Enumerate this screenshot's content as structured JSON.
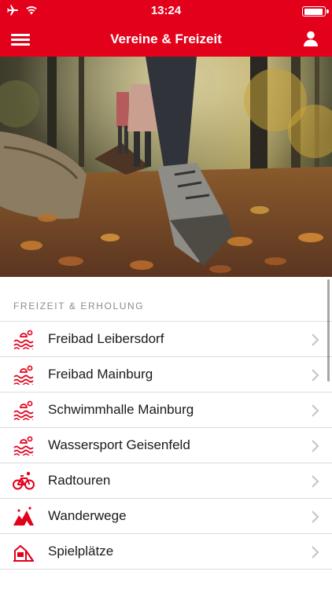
{
  "status_bar": {
    "time": "13:24",
    "battery_level": 0.9
  },
  "nav": {
    "title": "Vereine & Freizeit",
    "menu_icon": "hamburger-menu-icon",
    "user_icon": "user-profile-icon"
  },
  "section": {
    "title": "FREIZEIT & ERHOLUNG"
  },
  "items": [
    {
      "label": "Freibad Leibersdorf",
      "icon": "pool-icon"
    },
    {
      "label": "Freibad Mainburg",
      "icon": "pool-icon"
    },
    {
      "label": "Schwimmhalle Mainburg",
      "icon": "pool-icon"
    },
    {
      "label": "Wassersport Geisenfeld",
      "icon": "pool-icon"
    },
    {
      "label": "Radtouren",
      "icon": "bicycle-icon"
    },
    {
      "label": "Wanderwege",
      "icon": "mountain-icon"
    },
    {
      "label": "Spielplätze",
      "icon": "playground-icon"
    }
  ],
  "colors": {
    "brand": "#e3001b",
    "separator": "#dcdcdc",
    "chevron": "#c7c7cc"
  }
}
